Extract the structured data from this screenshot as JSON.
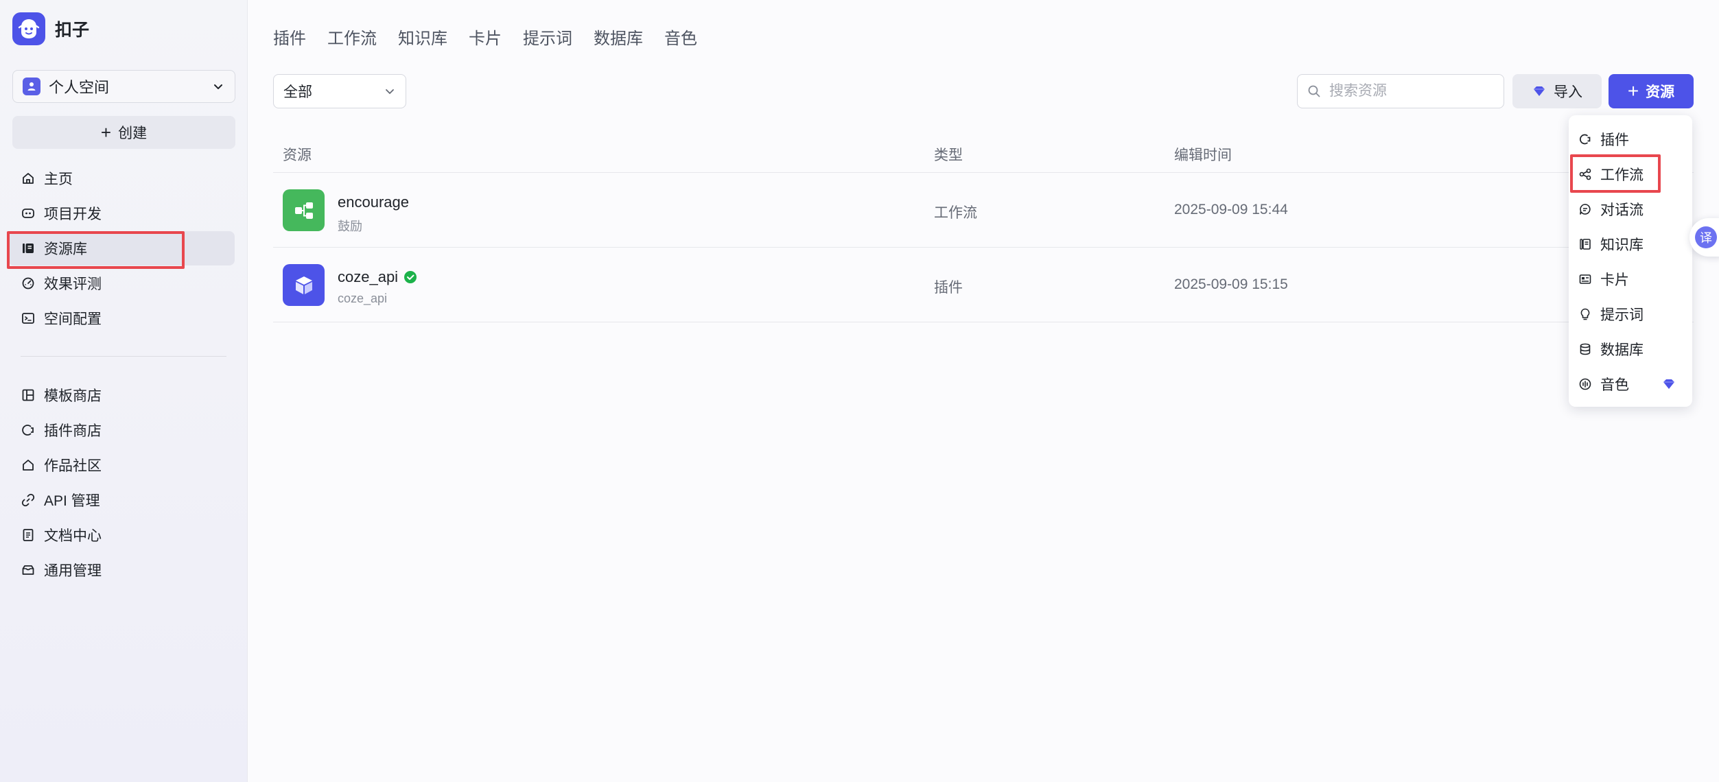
{
  "brand": {
    "name": "扣子"
  },
  "workspace": {
    "name": "个人空间"
  },
  "sidebar": {
    "create_label": "创建",
    "primary_items": [
      {
        "label": "主页",
        "icon": "home-icon"
      },
      {
        "label": "项目开发",
        "icon": "project-icon"
      },
      {
        "label": "资源库",
        "icon": "library-icon",
        "active": true
      },
      {
        "label": "效果评测",
        "icon": "evaluation-icon"
      },
      {
        "label": "空间配置",
        "icon": "config-icon"
      }
    ],
    "secondary_items": [
      {
        "label": "模板商店",
        "icon": "template-icon"
      },
      {
        "label": "插件商店",
        "icon": "plugin-icon"
      },
      {
        "label": "作品社区",
        "icon": "community-icon"
      },
      {
        "label": "API 管理",
        "icon": "api-icon"
      },
      {
        "label": "文档中心",
        "icon": "document-icon"
      },
      {
        "label": "通用管理",
        "icon": "manage-icon"
      }
    ]
  },
  "tabs": [
    "插件",
    "工作流",
    "知识库",
    "卡片",
    "提示词",
    "数据库",
    "音色"
  ],
  "filter": {
    "selected": "全部"
  },
  "search": {
    "placeholder": "搜索资源"
  },
  "toolbar": {
    "import_label": "导入",
    "resource_label": "资源"
  },
  "table": {
    "headers": {
      "resource": "资源",
      "type": "类型",
      "edit_time": "编辑时间"
    },
    "rows": [
      {
        "name": "encourage",
        "desc": "鼓励",
        "type": "工作流",
        "time": "2025-09-09 15:44",
        "icon": "workflow-icon",
        "color": "#45b85c",
        "verified": false
      },
      {
        "name": "coze_api",
        "desc": "coze_api",
        "type": "插件",
        "time": "2025-09-09 15:15",
        "icon": "plugin-cube-icon",
        "color": "#4d53e8",
        "verified": true
      }
    ]
  },
  "menu": {
    "items": [
      {
        "label": "插件",
        "icon": "plugin-icon"
      },
      {
        "label": "工作流",
        "icon": "workflow-icon",
        "highlighted": true
      },
      {
        "label": "对话流",
        "icon": "chatflow-icon"
      },
      {
        "label": "知识库",
        "icon": "knowledge-icon"
      },
      {
        "label": "卡片",
        "icon": "card-icon"
      },
      {
        "label": "提示词",
        "icon": "prompt-icon"
      },
      {
        "label": "数据库",
        "icon": "database-icon"
      },
      {
        "label": "音色",
        "icon": "voice-icon",
        "premium": true
      }
    ]
  },
  "translate": {
    "label": "译"
  },
  "colors": {
    "accent": "#4d53e8",
    "highlight": "#e8474e",
    "success": "#1cb24a"
  }
}
